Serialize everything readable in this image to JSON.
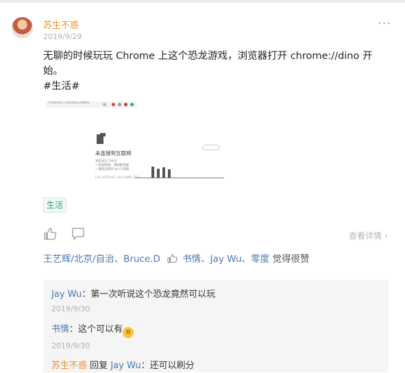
{
  "post": {
    "author": "苏生不惑",
    "date": "2019/9/29",
    "more_label": "···",
    "text_line1": "无聊的时候玩玩 Chrome 上这个恐龙游戏，浏览器打开 chrome://dino 开",
    "text_line2": "始。",
    "hashtag": "#生活#",
    "tag": "生活",
    "detail_label": "查看详情",
    "screenshot": {
      "address": "Chrome | chrome://dino",
      "title": "未连接到互联网",
      "tips": [
        "请试试以下办法：",
        "• 检查网线、调制解调器",
        "• 重新连接到 Wi-Fi 网络"
      ],
      "code": "ERR_INTERNET_DISCONNECTED"
    }
  },
  "likes": {
    "names_a": "王艺辉/北京/自治、Bruce.D",
    "names_b": "书情、Jay Wu、零度",
    "suffix": "觉得很赞"
  },
  "comments": [
    {
      "author": "Jay Wu",
      "sep": "：",
      "text": "第一次听说这个恐龙竟然可以玩",
      "date": "2019/9/30"
    },
    {
      "author": "书情",
      "sep": "：",
      "text": "这个可以有",
      "emoji": "grin-emoji",
      "date": "2019/9/30"
    },
    {
      "author": "苏生不惑",
      "reply_word": "回复",
      "reply_to": "Jay Wu",
      "sep": "：",
      "text": "还可以刷分"
    }
  ]
}
